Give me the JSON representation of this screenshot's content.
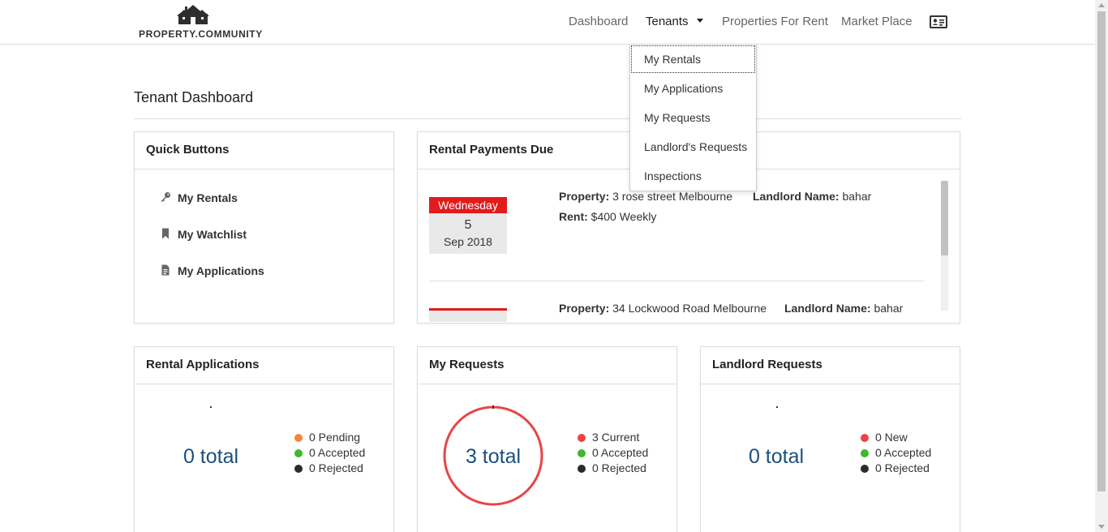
{
  "header": {
    "logo_text": "PROPERTY.COMMUNITY",
    "nav": [
      {
        "label": "Dashboard"
      },
      {
        "label": "Tenants"
      },
      {
        "label": "Properties For Rent"
      },
      {
        "label": "Market Place"
      }
    ],
    "profile_icon": "id-card-icon"
  },
  "tenants_menu": {
    "items": [
      {
        "label": "My Rentals"
      },
      {
        "label": "My Applications"
      },
      {
        "label": "My Requests"
      },
      {
        "label": "Landlord's Requests"
      },
      {
        "label": "Inspections"
      }
    ]
  },
  "page": {
    "title": "Tenant Dashboard"
  },
  "quick_buttons": {
    "title": "Quick Buttons",
    "items": [
      {
        "label": "My Rentals",
        "icon": "key-icon"
      },
      {
        "label": "My Watchlist",
        "icon": "bookmark-icon"
      },
      {
        "label": "My Applications",
        "icon": "document-icon"
      }
    ]
  },
  "payments": {
    "title": "Rental Payments Due",
    "property_label": "Property:",
    "landlord_label": "Landlord Name:",
    "rent_label": "Rent:",
    "entries": [
      {
        "day": "Wednesday",
        "date": "5",
        "month_year": "Sep 2018",
        "property": "3 rose street Melbourne",
        "landlord": "bahar",
        "rent": "$400 Weekly"
      },
      {
        "property": "34 Lockwood Road Melbourne",
        "landlord": "bahar"
      }
    ]
  },
  "rental_applications": {
    "title": "Rental Applications",
    "total": "0 total",
    "legend": [
      {
        "label": "0 Pending",
        "color": "#f0883e"
      },
      {
        "label": "0 Accepted",
        "color": "#3db82f"
      },
      {
        "label": "0 Rejected",
        "color": "#2b2b2b"
      }
    ]
  },
  "my_requests": {
    "title": "My Requests",
    "total": "3 total",
    "ring_color": "#e84545",
    "legend": [
      {
        "label": "3 Current",
        "color": "#e84545"
      },
      {
        "label": "0 Accepted",
        "color": "#3db82f"
      },
      {
        "label": "0 Rejected",
        "color": "#2b2b2b"
      }
    ]
  },
  "landlord_requests": {
    "title": "Landlord Requests",
    "total": "0 total",
    "legend": [
      {
        "label": "0 New",
        "color": "#e84545"
      },
      {
        "label": "0 Accepted",
        "color": "#3db82f"
      },
      {
        "label": "0 Rejected",
        "color": "#2b2b2b"
      }
    ]
  }
}
